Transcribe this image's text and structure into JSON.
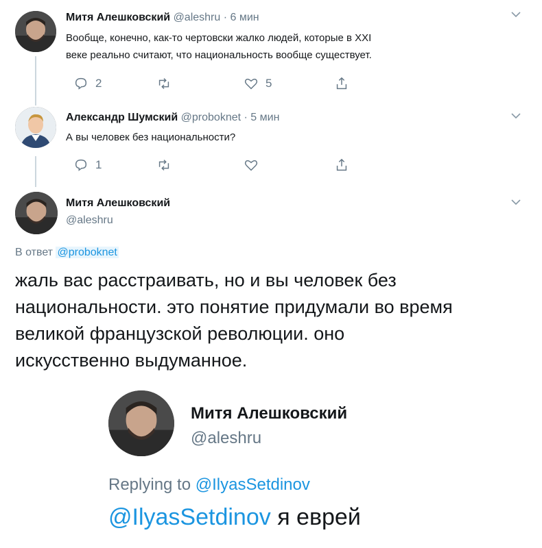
{
  "tweet1": {
    "name": "Митя Алешковский",
    "handle": "@aleshru",
    "time": "· 6 мин",
    "text_line1": "Вообще, конечно, как-то чертовски жалко людей, которые в XXI",
    "text_line2": "веке реально считают, что национальность вообще существует.",
    "reply_count": "2",
    "retweet_count": "",
    "like_count": "5"
  },
  "tweet2": {
    "name": "Александр Шумский",
    "handle": "@proboknet",
    "time": "· 5 мин",
    "text": "А вы человек без национальности?",
    "reply_count": "1",
    "retweet_count": "",
    "like_count": ""
  },
  "tweet3": {
    "name": "Митя Алешковский",
    "handle": "@aleshru",
    "reply_prefix": "В ответ",
    "reply_to": "@proboknet",
    "text_line1": "жаль вас расстраивать, но и вы человек без",
    "text_line2": "национальности. это понятие придумали во время",
    "text_line3": "великой французской революции. оно",
    "text_line4": "искусственно выдуманное."
  },
  "tweet4": {
    "name": "Митя Алешковский",
    "handle": "@aleshru",
    "reply_prefix": "Replying to",
    "reply_to": "@IlyasSetdinov",
    "mention": "@IlyasSetdinov",
    "text": " я еврей"
  },
  "icons": {
    "chevron": "chevron-down-icon",
    "reply": "reply-icon",
    "retweet": "retweet-icon",
    "like": "heart-icon",
    "share": "share-icon"
  },
  "colors": {
    "link": "#1b95e0",
    "muted": "#657786",
    "text": "#14171a"
  }
}
